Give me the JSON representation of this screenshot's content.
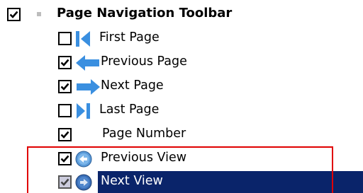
{
  "header": {
    "label": "Page Navigation Toolbar",
    "checked": true
  },
  "items": [
    {
      "label": "First Page",
      "checked": false,
      "icon": "first-page-icon"
    },
    {
      "label": "Previous Page",
      "checked": true,
      "icon": "previous-page-arrow-icon"
    },
    {
      "label": "Next Page",
      "checked": true,
      "icon": "next-page-arrow-icon"
    },
    {
      "label": "Last Page",
      "checked": false,
      "icon": "last-page-icon"
    },
    {
      "label": "Page Number",
      "checked": true,
      "icon": ""
    },
    {
      "label": "Previous View",
      "checked": true,
      "icon": "previous-view-icon"
    },
    {
      "label": "Next View",
      "checked": true,
      "icon": "next-view-icon",
      "selected": true
    }
  ],
  "colors": {
    "selection": "#0a246a",
    "highlight_box": "#e00000",
    "arrow_blue": "#3a8fe0",
    "checkmark": "#000000"
  }
}
